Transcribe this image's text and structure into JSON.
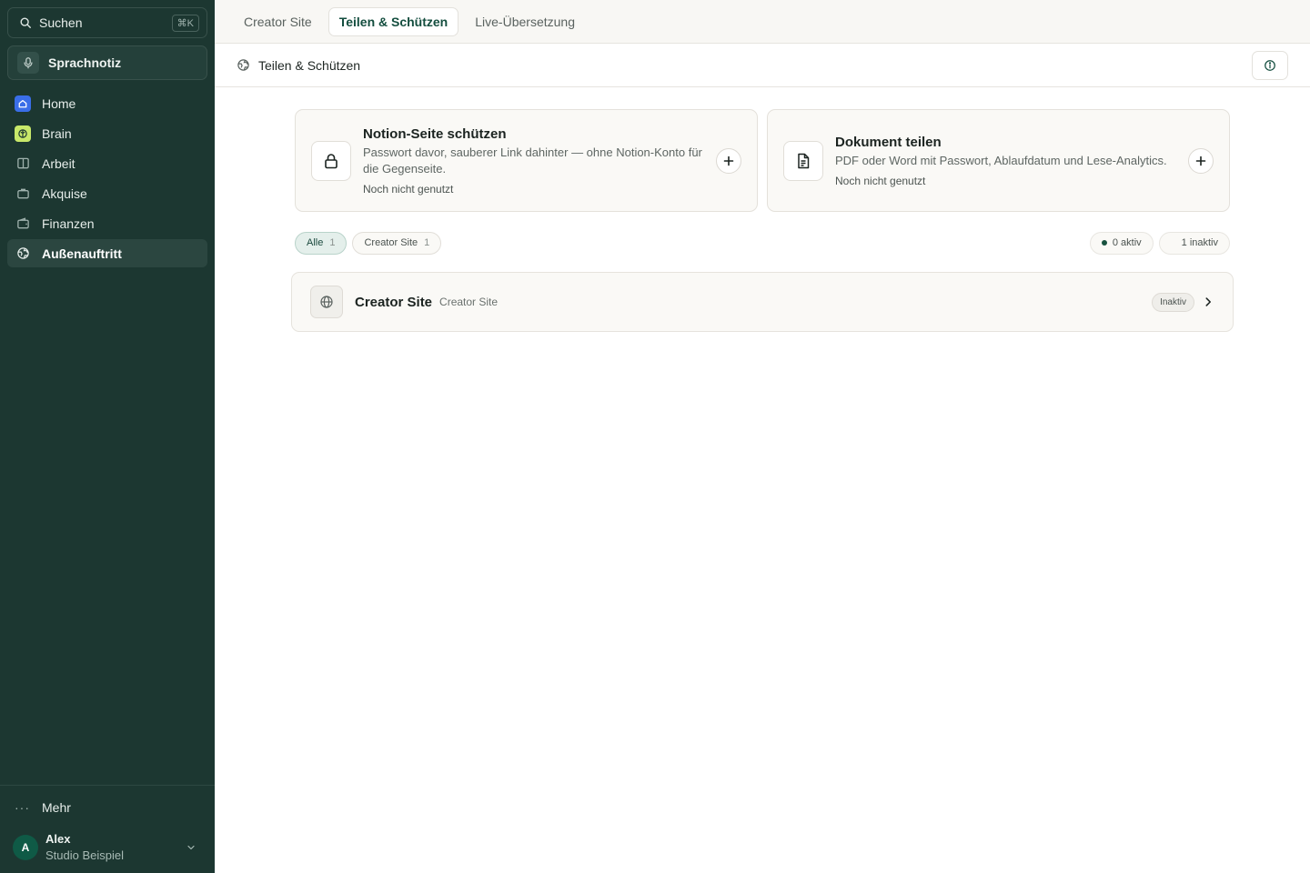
{
  "sidebar": {
    "search": {
      "label": "Suchen",
      "shortcut": "⌘K"
    },
    "voice_note": "Sprachnotiz",
    "items": [
      {
        "label": "Home",
        "icon": "home-icon",
        "color": "#3a6ee8"
      },
      {
        "label": "Brain",
        "icon": "brain-icon",
        "color": "#c8e86a"
      },
      {
        "label": "Arbeit",
        "icon": "columns-icon"
      },
      {
        "label": "Akquise",
        "icon": "briefcase-icon"
      },
      {
        "label": "Finanzen",
        "icon": "wallet-icon"
      },
      {
        "label": "Außenauftritt",
        "icon": "globe-icon",
        "active": true
      }
    ],
    "more": "Mehr",
    "user": {
      "initial": "A",
      "name": "Alex",
      "org": "Studio Beispiel"
    }
  },
  "tabs": [
    {
      "label": "Creator Site",
      "active": false
    },
    {
      "label": "Teilen & Schützen",
      "active": true
    },
    {
      "label": "Live-Übersetzung",
      "active": false
    }
  ],
  "subheader": {
    "title": "Teilen & Schützen"
  },
  "cards": [
    {
      "title": "Notion-Seite schützen",
      "description": "Passwort davor, sauberer Link dahinter — ohne Notion-Konto für die Gegenseite.",
      "status": "Noch nicht genutzt",
      "icon": "lock-icon"
    },
    {
      "title": "Dokument teilen",
      "description": "PDF oder Word mit Passwort, Ablaufdatum und Lese-Analytics.",
      "status": "Noch nicht genutzt",
      "icon": "document-icon"
    }
  ],
  "filters": [
    {
      "label": "Alle",
      "count": "1",
      "active": true
    },
    {
      "label": "Creator Site",
      "count": "1",
      "active": false
    }
  ],
  "stats": {
    "active": "0 aktiv",
    "inactive": "1 inaktiv"
  },
  "items": [
    {
      "title": "Creator Site",
      "subtitle": "Creator Site",
      "status": "Inaktiv",
      "icon": "globe-icon"
    }
  ],
  "colors": {
    "sidebar_bg": "#1c3731",
    "accent": "#144e3f",
    "active_dot": "#17523f"
  }
}
